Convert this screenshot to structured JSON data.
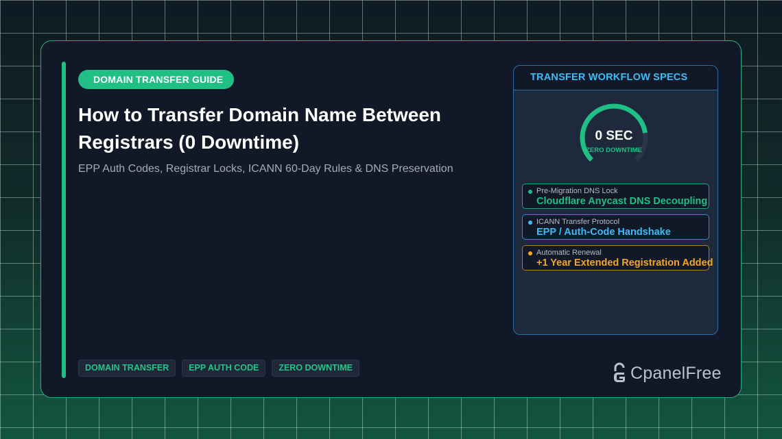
{
  "badge": "DOMAIN TRANSFER GUIDE",
  "title": "How to Transfer Domain Name Between Registrars (0 Downtime)",
  "subtitle": "EPP Auth Codes, Registrar Locks, ICANN 60-Day Rules & DNS Preservation",
  "tags": [
    "DOMAIN TRANSFER",
    "EPP AUTH CODE",
    "ZERO DOWNTIME"
  ],
  "panel": {
    "header": "TRANSFER WORKFLOW SPECS",
    "gauge": {
      "value": "0 SEC",
      "label": "ZERO DOWNTIME",
      "fill_fraction": 0.8
    },
    "specs": [
      {
        "label": "Pre-Migration DNS Lock",
        "value": "Cloudflare Anycast DNS Decoupling",
        "color": "#1fbf86"
      },
      {
        "label": "ICANN Transfer Protocol",
        "value": "EPP / Auth-Code Handshake",
        "color": "#38bdf8"
      },
      {
        "label": "Automatic Renewal",
        "value": "+1 Year Extended Registration Added",
        "color": "#f5a524"
      }
    ]
  },
  "logo": {
    "text": "CpanelFree",
    "icon": "padlock-icon"
  },
  "colors": {
    "accent": "#1fbf86",
    "blue": "#38bdf8",
    "orange": "#f5a524",
    "card": "#111827"
  }
}
